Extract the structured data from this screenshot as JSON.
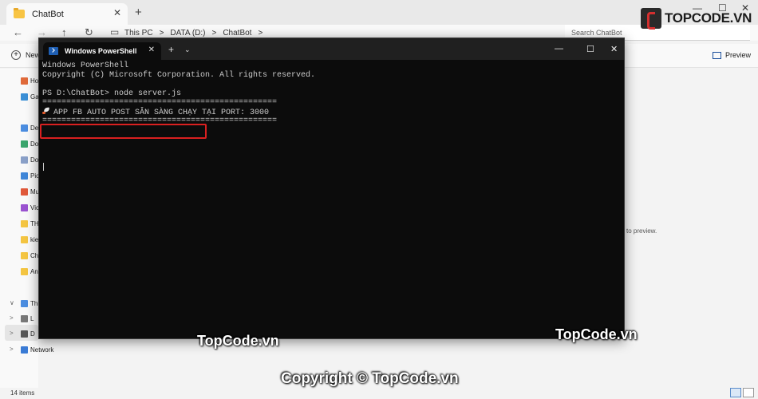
{
  "explorer": {
    "tab_title": "ChatBot",
    "tab_close": "✕",
    "new_tab": "+",
    "caption": {
      "minimize": "—",
      "maximize": "☐",
      "close": "✕"
    },
    "nav": {
      "back": "←",
      "forward": "→",
      "up": "↑",
      "refresh": "↻",
      "pc": "▭"
    },
    "breadcrumb": [
      "This PC",
      ">",
      "DATA (D:)",
      ">",
      "ChatBot",
      ">"
    ],
    "search_placeholder": "Search ChatBot",
    "new_label": "New",
    "preview_label": "Preview",
    "sidebar": [
      {
        "label": "Ho",
        "color": "#e06a3a"
      },
      {
        "label": "Ga",
        "color": "#3a8fd6"
      },
      {
        "label": "De",
        "color": "#4b8de0"
      },
      {
        "label": "Do",
        "color": "#3aa56c"
      },
      {
        "label": "Do",
        "color": "#8aa0c8"
      },
      {
        "label": "Pic",
        "color": "#3f86d8"
      },
      {
        "label": "Mu",
        "color": "#e0583a"
      },
      {
        "label": "Vic",
        "color": "#9a52d0"
      },
      {
        "label": "TH",
        "color": "#f4c542"
      },
      {
        "label": "kie",
        "color": "#f4c542"
      },
      {
        "label": "Ch",
        "color": "#f4c542"
      },
      {
        "label": "An",
        "color": "#f4c542"
      }
    ],
    "tree": [
      {
        "chev": "∨",
        "label": "Thi",
        "color": "#4b8de0"
      },
      {
        "chev": ">",
        "label": "L",
        "color": "#777777"
      },
      {
        "chev": ">",
        "label": "D",
        "color": "#555555"
      },
      {
        "chev": ">",
        "label": "Network",
        "color": "#3a7bd5"
      }
    ],
    "empty_message": "to preview.",
    "status_items": "14 items"
  },
  "logo": {
    "text": "TOPCODE.VN"
  },
  "terminal": {
    "tab_title": "Windows PowerShell",
    "tab_close": "✕",
    "new_tab": "+",
    "dropdown": "⌄",
    "caption": {
      "minimize": "—",
      "maximize": "☐",
      "close": "✕"
    },
    "lines": [
      "Windows PowerShell",
      "Copyright (C) Microsoft Corporation. All rights reserved.",
      "",
      "PS D:\\ChatBot> node server.js",
      "=================================================",
      "APP FB AUTO POST SẴN SÀNG CHẠY TẠI PORT: 3000",
      "================================================="
    ]
  },
  "watermarks": {
    "left": "TopCode.vn",
    "right": "TopCode.vn",
    "bottom": "Copyright © TopCode.vn"
  }
}
